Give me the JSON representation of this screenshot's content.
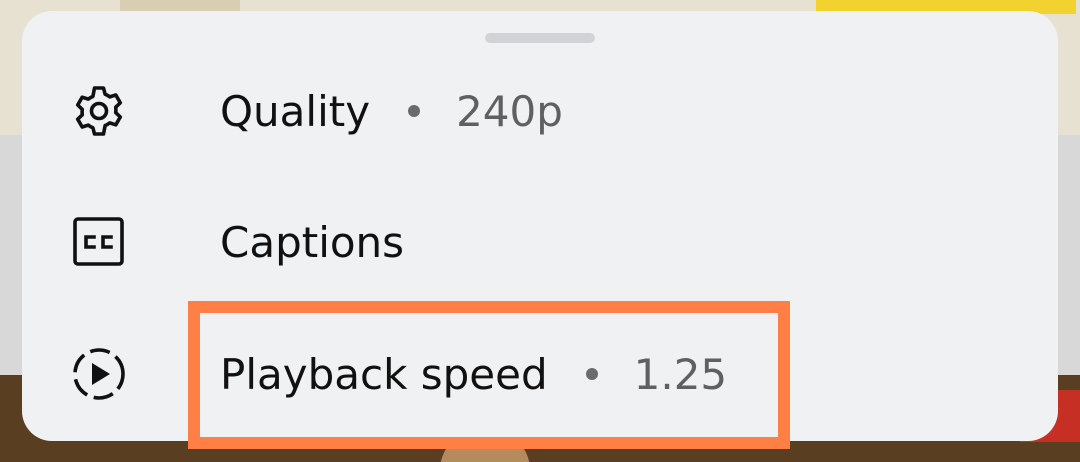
{
  "sheet": {
    "items": [
      {
        "label": "Quality",
        "value": "240p",
        "icon": "gear-icon"
      },
      {
        "label": "Captions",
        "value": "",
        "icon": "closed-captions-icon"
      },
      {
        "label": "Playback speed",
        "value": "1.25",
        "icon": "playback-speed-icon"
      }
    ]
  },
  "colors": {
    "sheet_background": "#f0f1f3",
    "highlight": "#ff7f45",
    "label": "#111111",
    "value": "#606060"
  }
}
